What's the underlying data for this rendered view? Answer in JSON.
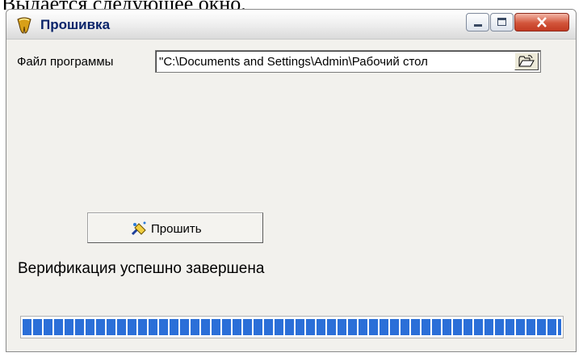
{
  "document": {
    "caption": "Выдается следующее окно."
  },
  "window": {
    "title": "Прошивка",
    "icon": "tooth-app-icon"
  },
  "form": {
    "file_label": "Файл программы",
    "file_path": "\"C:\\Documents and Settings\\Admin\\Рабочий стол",
    "browse_icon": "folder-open-icon",
    "flash_button_label": "Прошить",
    "flash_button_icon": "wand-icon"
  },
  "status": {
    "message": "Верификация успешно завершена"
  },
  "progress": {
    "percent": 100
  },
  "colors": {
    "progress_block": "#2b6fd8",
    "title_text": "#0a246a",
    "close_button": "#c33b22"
  }
}
